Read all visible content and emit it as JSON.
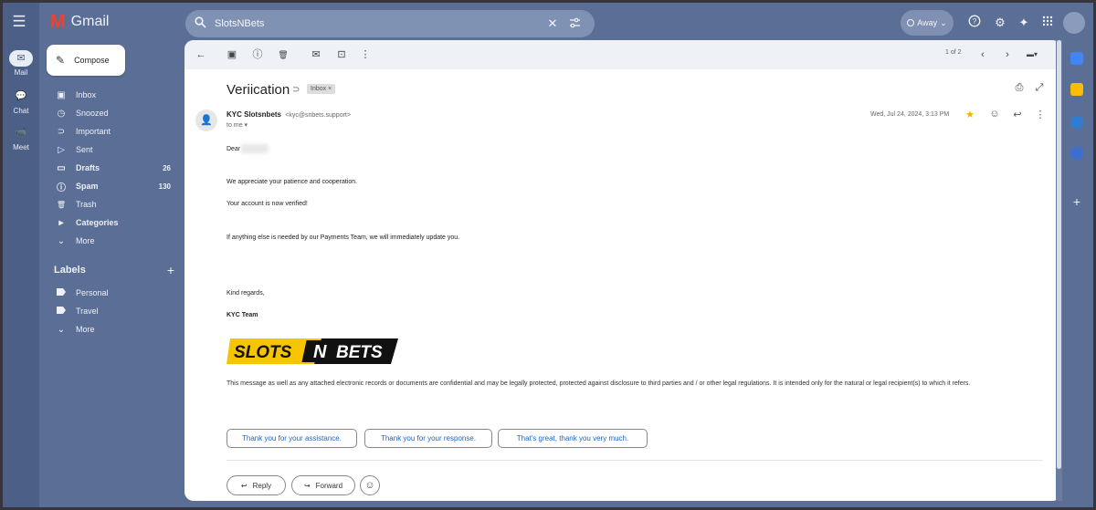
{
  "app": {
    "name": "Gmail",
    "logo_letter": "M"
  },
  "rail": {
    "menu_icon": "☰",
    "items": [
      {
        "label": "Mail",
        "icon": "✉"
      },
      {
        "label": "Chat",
        "icon": "💬"
      },
      {
        "label": "Meet",
        "icon": "📹"
      }
    ]
  },
  "search": {
    "value": "SlotsNBets",
    "icon": "search-icon",
    "clear_icon": "✕",
    "tune_icon": "⚙"
  },
  "status": {
    "label": "Away",
    "chevron": "⌄"
  },
  "top_icons": {
    "help": "?",
    "settings": "⚙",
    "gemini": "✦",
    "apps": "⋮⋮"
  },
  "compose": {
    "label": "Compose",
    "icon": "✎"
  },
  "sidebar": {
    "items": [
      {
        "label": "Inbox",
        "icon": "▣",
        "count": "",
        "bold": false
      },
      {
        "label": "Snoozed",
        "icon": "◷",
        "count": "",
        "bold": false
      },
      {
        "label": "Important",
        "icon": "⊃",
        "count": "",
        "bold": false
      },
      {
        "label": "Sent",
        "icon": "▷",
        "count": "",
        "bold": false
      },
      {
        "label": "Drafts",
        "icon": "▭",
        "count": "26",
        "bold": true
      },
      {
        "label": "Spam",
        "icon": "ⓘ",
        "count": "130",
        "bold": true
      },
      {
        "label": "Trash",
        "icon": "🗑",
        "count": "",
        "bold": false
      },
      {
        "label": "Categories",
        "icon": "▸",
        "count": "",
        "bold": true
      },
      {
        "label": "More",
        "icon": "⌄",
        "count": "",
        "bold": false
      }
    ],
    "labels_title": "Labels",
    "labels_add": "+",
    "labels": [
      {
        "label": "Personal"
      },
      {
        "label": "Travel"
      },
      {
        "label": "More"
      }
    ]
  },
  "toolbar": {
    "back": "←",
    "archive": "▣",
    "report": "ⓘ",
    "delete": "🗑",
    "mark_unread": "✉",
    "move": "⊡",
    "more": "⋮",
    "pager": "1 of 2",
    "prev": "‹",
    "next": "›",
    "input_tools": "▬▾"
  },
  "message": {
    "subject": "Veriication",
    "subject_tag_icon": "⊃",
    "label_chip": "Inbox ×",
    "print_icon": "⎙",
    "open_new_icon": "⤢",
    "sender_name": "KYC Slotsnbets",
    "sender_email": "<kyc@snbets.support>",
    "to": "to me ▾",
    "date": "Wed, Jul 24, 2024, 3:13 PM",
    "star_icon": "★",
    "emoji_icon": "☺",
    "reply_icon": "↩",
    "more_icon": "⋮",
    "greeting": "Dear",
    "lines": [
      "We appreciate your patience and cooperation.",
      "Your account is now verified!",
      "If anything else is needed by our Payments Team, we will immediately update you.",
      "Kind regards,",
      "KYC Team"
    ],
    "brand": {
      "part1": "SLOTS",
      "part2": "N",
      "part3": "BETS",
      "yellow": "#f7c400",
      "black": "#111111"
    },
    "disclaimer": "This message as well as any attached electronic records or documents are confidential and may be legally protected, protected against disclosure to third parties and / or other legal regulations. It is intended only for the natural or legal recipient(s) to which it refers.",
    "smart_replies": [
      "Thank you for your assistance.",
      "Thank you for your response.",
      "That's great, thank you very much."
    ],
    "reply_label": "Reply",
    "reply_btn_icon": "↩",
    "forward_label": "Forward",
    "forward_btn_icon": "↪",
    "emoji_btn_icon": "☺"
  },
  "colors": {
    "frame": "#5b6e95",
    "rail": "#4c5f86",
    "accent_link": "#1a66c2",
    "star": "#f4b400"
  }
}
